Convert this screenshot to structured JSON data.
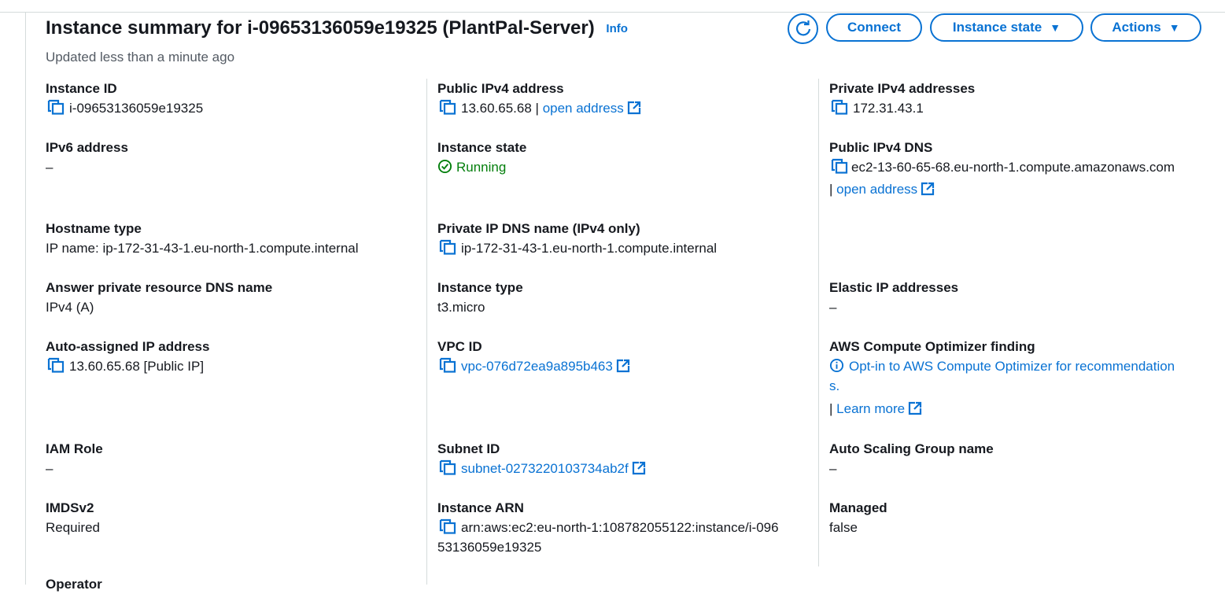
{
  "header": {
    "title": "Instance summary for i-09653136059e19325 (PlantPal-Server)",
    "info_link": "Info",
    "updated": "Updated less than a minute ago",
    "buttons": {
      "refresh_icon": "refresh-icon",
      "connect": "Connect",
      "instance_state": "Instance state",
      "actions": "Actions"
    }
  },
  "col1": {
    "instance_id": {
      "label": "Instance ID",
      "value": "i-09653136059e19325"
    },
    "ipv6": {
      "label": "IPv6 address",
      "value": "–"
    },
    "hostname_type": {
      "label": "Hostname type",
      "value": "IP name: ip-172-31-43-1.eu-north-1.compute.internal"
    },
    "answer_dns": {
      "label": "Answer private resource DNS name",
      "value": "IPv4 (A)"
    },
    "auto_ip": {
      "label": "Auto-assigned IP address",
      "value": "13.60.65.68 [Public IP]"
    },
    "iam_role": {
      "label": "IAM Role",
      "value": "–"
    },
    "imdsv2": {
      "label": "IMDSv2",
      "value": "Required"
    },
    "cut_label": "Operator"
  },
  "col2": {
    "public_ipv4": {
      "label": "Public IPv4 address",
      "value": "13.60.65.68 |",
      "link": "open address"
    },
    "instance_state": {
      "label": "Instance state",
      "value": "Running"
    },
    "private_dns": {
      "label": "Private IP DNS name (IPv4 only)",
      "value": "ip-172-31-43-1.eu-north-1.compute.internal"
    },
    "instance_type": {
      "label": "Instance type",
      "value": "t3.micro"
    },
    "vpc_id": {
      "label": "VPC ID",
      "value": "vpc-076d72ea9a895b463"
    },
    "subnet_id": {
      "label": "Subnet ID",
      "value": "subnet-0273220103734ab2f"
    },
    "instance_arn": {
      "label": "Instance ARN",
      "line1": "arn:aws:ec2:eu-north-1:108782055122:instance/i-096",
      "line2": "53136059e19325"
    }
  },
  "col3": {
    "private_ipv4": {
      "label": "Private IPv4 addresses",
      "value": "172.31.43.1"
    },
    "public_dns": {
      "label": "Public IPv4 DNS",
      "value": "ec2-13-60-65-68.eu-north-1.compute.amazonaws.com",
      "sep": "|",
      "link": "open address"
    },
    "elastic_ip": {
      "label": "Elastic IP addresses",
      "value": "–"
    },
    "optimizer": {
      "label": "AWS Compute Optimizer finding",
      "link_line1": "Opt-in to AWS Compute Optimizer for recommendation",
      "link_line2": "s.",
      "sep": "|",
      "learn_more": "Learn more"
    },
    "asg": {
      "label": "Auto Scaling Group name",
      "value": "–"
    },
    "managed": {
      "label": "Managed",
      "value": "false"
    }
  },
  "colors": {
    "link": "#0972d3",
    "success": "#037f0c",
    "text": "#16191f",
    "subtle": "#545b64",
    "divider": "#d5dbdb"
  }
}
